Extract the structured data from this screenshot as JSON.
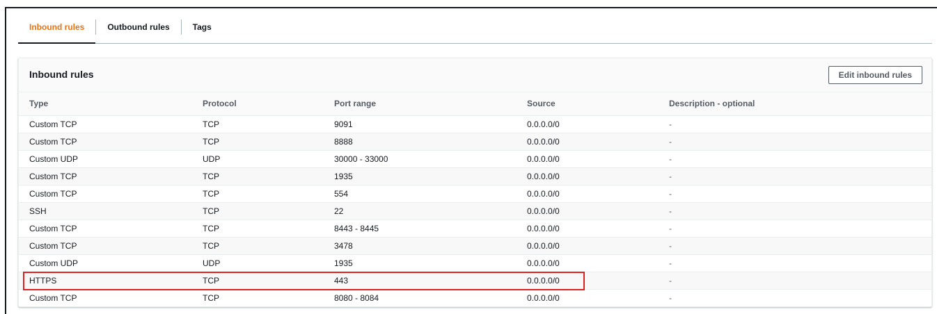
{
  "tabs": [
    {
      "label": "Inbound rules",
      "active": true
    },
    {
      "label": "Outbound rules",
      "active": false
    },
    {
      "label": "Tags",
      "active": false
    }
  ],
  "panel": {
    "title": "Inbound rules",
    "edit_button_label": "Edit inbound rules"
  },
  "table": {
    "columns": [
      "Type",
      "Protocol",
      "Port range",
      "Source",
      "Description - optional"
    ],
    "rows": [
      {
        "type": "Custom TCP",
        "protocol": "TCP",
        "port_range": "9091",
        "source": "0.0.0.0/0",
        "description": "-"
      },
      {
        "type": "Custom TCP",
        "protocol": "TCP",
        "port_range": "8888",
        "source": "0.0.0.0/0",
        "description": "-"
      },
      {
        "type": "Custom UDP",
        "protocol": "UDP",
        "port_range": "30000 - 33000",
        "source": "0.0.0.0/0",
        "description": "-"
      },
      {
        "type": "Custom TCP",
        "protocol": "TCP",
        "port_range": "1935",
        "source": "0.0.0.0/0",
        "description": "-"
      },
      {
        "type": "Custom TCP",
        "protocol": "TCP",
        "port_range": "554",
        "source": "0.0.0.0/0",
        "description": "-"
      },
      {
        "type": "SSH",
        "protocol": "TCP",
        "port_range": "22",
        "source": "0.0.0.0/0",
        "description": "-"
      },
      {
        "type": "Custom TCP",
        "protocol": "TCP",
        "port_range": "8443 - 8445",
        "source": "0.0.0.0/0",
        "description": "-"
      },
      {
        "type": "Custom TCP",
        "protocol": "TCP",
        "port_range": "3478",
        "source": "0.0.0.0/0",
        "description": "-"
      },
      {
        "type": "Custom UDP",
        "protocol": "UDP",
        "port_range": "1935",
        "source": "0.0.0.0/0",
        "description": "-"
      },
      {
        "type": "HTTPS",
        "protocol": "TCP",
        "port_range": "443",
        "source": "0.0.0.0/0",
        "description": "-"
      },
      {
        "type": "Custom TCP",
        "protocol": "TCP",
        "port_range": "8080 - 8084",
        "source": "0.0.0.0/0",
        "description": "-"
      }
    ]
  },
  "colors": {
    "active_tab": "#ec7211",
    "highlight_border": "#e02020",
    "text": "#16191f",
    "muted_text": "#545b64"
  }
}
